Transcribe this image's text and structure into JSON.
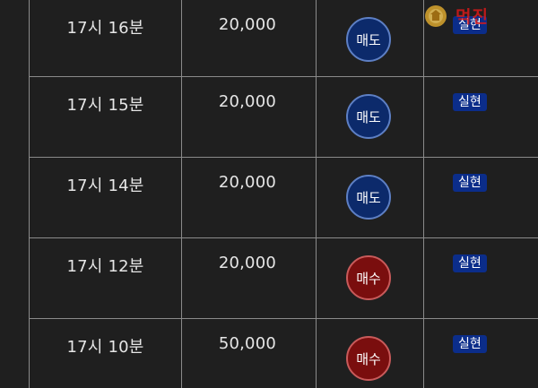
{
  "rows": [
    {
      "time": "17시 16분",
      "price": "20,000",
      "side": "매도",
      "side_type": "sell",
      "status": "실현"
    },
    {
      "time": "17시 15분",
      "price": "20,000",
      "side": "매도",
      "side_type": "sell",
      "status": "실현"
    },
    {
      "time": "17시 14분",
      "price": "20,000",
      "side": "매도",
      "side_type": "sell",
      "status": "실현"
    },
    {
      "time": "17시 12분",
      "price": "20,000",
      "side": "매수",
      "side_type": "buy",
      "status": "실현"
    },
    {
      "time": "17시 10분",
      "price": "50,000",
      "side": "매수",
      "side_type": "buy",
      "status": "실현"
    }
  ],
  "watermark": {
    "text": "먹진",
    "icon": "coin-emblem-icon"
  },
  "colors": {
    "background": "#1f1f1f",
    "sell": "#0c2a6b",
    "buy": "#7a0e0e",
    "status": "#0b2d8a",
    "grid": "#8a8a8a"
  }
}
